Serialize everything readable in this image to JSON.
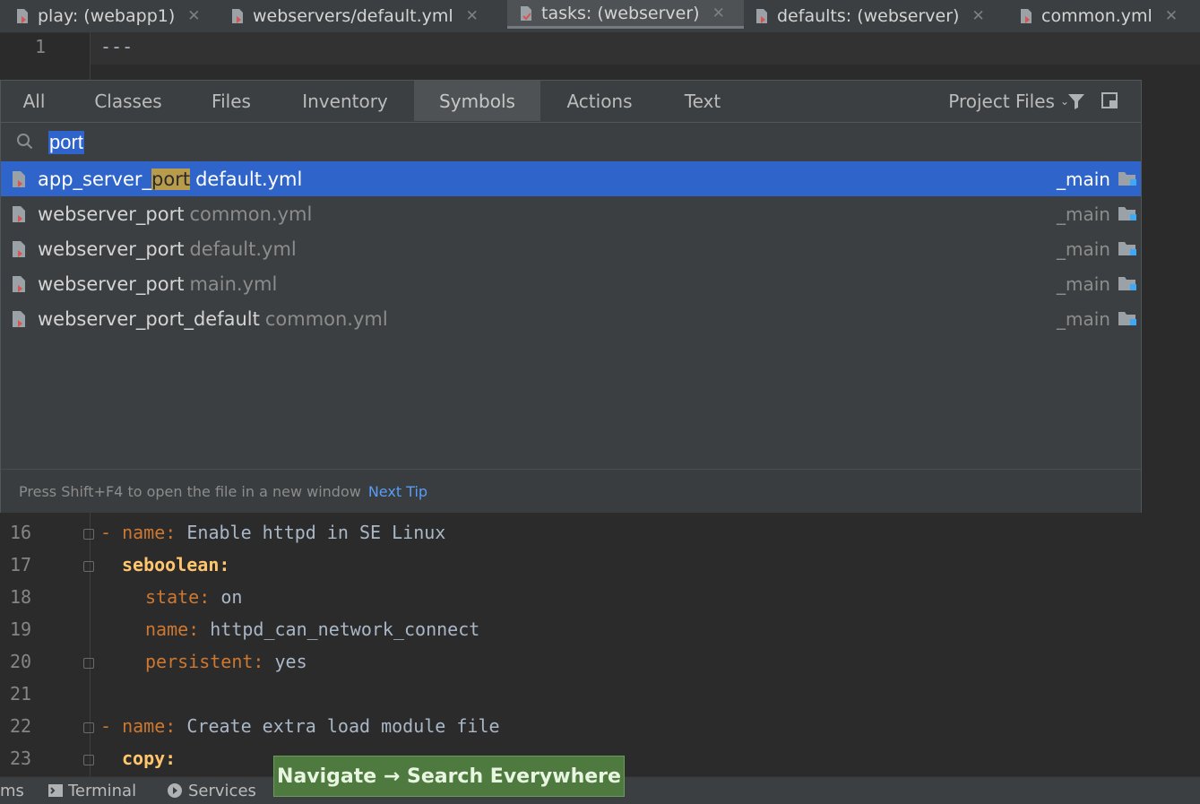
{
  "tabs": [
    {
      "label": "play: (webapp1)",
      "active": false
    },
    {
      "label": "webservers/default.yml",
      "active": false
    },
    {
      "label": "tasks: (webserver)",
      "active": true
    },
    {
      "label": "defaults: (webserver)",
      "active": false
    },
    {
      "label": "common.yml",
      "active": false
    }
  ],
  "editor_top": {
    "line_number": "1",
    "code": "---"
  },
  "popup": {
    "tabs": [
      "All",
      "Classes",
      "Files",
      "Inventory",
      "Symbols",
      "Actions",
      "Text"
    ],
    "selected_tab": "Symbols",
    "scope_label": "Project Files",
    "search_value": "port",
    "results": [
      {
        "prefix": "app_server_",
        "match": "port",
        "suffix": "",
        "file": "default.yml",
        "module": "_main",
        "selected": true
      },
      {
        "prefix": "webserver_",
        "match": "port",
        "suffix": "",
        "file": "common.yml",
        "module": "_main",
        "selected": false
      },
      {
        "prefix": "webserver_",
        "match": "port",
        "suffix": "",
        "file": "default.yml",
        "module": "_main",
        "selected": false
      },
      {
        "prefix": "webserver_",
        "match": "port",
        "suffix": "",
        "file": "main.yml",
        "module": "_main",
        "selected": false
      },
      {
        "prefix": "webserver_",
        "match": "port",
        "suffix": "_default",
        "file": "common.yml",
        "module": "_main",
        "selected": false
      }
    ],
    "footer_tip": "Press Shift+F4 to open the file in a new window",
    "footer_link": "Next Tip"
  },
  "code_lines": [
    {
      "num": "16",
      "dash": "- ",
      "key": "name",
      "sep": ": ",
      "value": "Enable httpd in SE Linux",
      "indent": 0
    },
    {
      "num": "17",
      "dash": "",
      "key": "seboolean",
      "sep": ":",
      "value": "",
      "indent": 1,
      "section": true
    },
    {
      "num": "18",
      "dash": "",
      "key": "state",
      "sep": ": ",
      "value": "on",
      "indent": 2
    },
    {
      "num": "19",
      "dash": "",
      "key": "name",
      "sep": ": ",
      "value": "httpd_can_network_connect",
      "indent": 2
    },
    {
      "num": "20",
      "dash": "",
      "key": "persistent",
      "sep": ": ",
      "value": "yes",
      "indent": 2
    },
    {
      "num": "21",
      "dash": "",
      "key": "",
      "sep": "",
      "value": "",
      "indent": 0
    },
    {
      "num": "22",
      "dash": "- ",
      "key": "name",
      "sep": ": ",
      "value": "Create extra load module file",
      "indent": 0
    },
    {
      "num": "23",
      "dash": "",
      "key": "copy",
      "sep": ":",
      "value": "",
      "indent": 1,
      "section": true
    }
  ],
  "statusbar": {
    "problems_partial": "ms",
    "terminal": "Terminal",
    "services": "Services"
  },
  "tooltip": "Navigate → Search Everywhere",
  "colors": {
    "accent": "#2f65ca",
    "highlight": "#b89c4c",
    "tooltip_bg": "#4f7a3f",
    "link": "#589df6"
  }
}
